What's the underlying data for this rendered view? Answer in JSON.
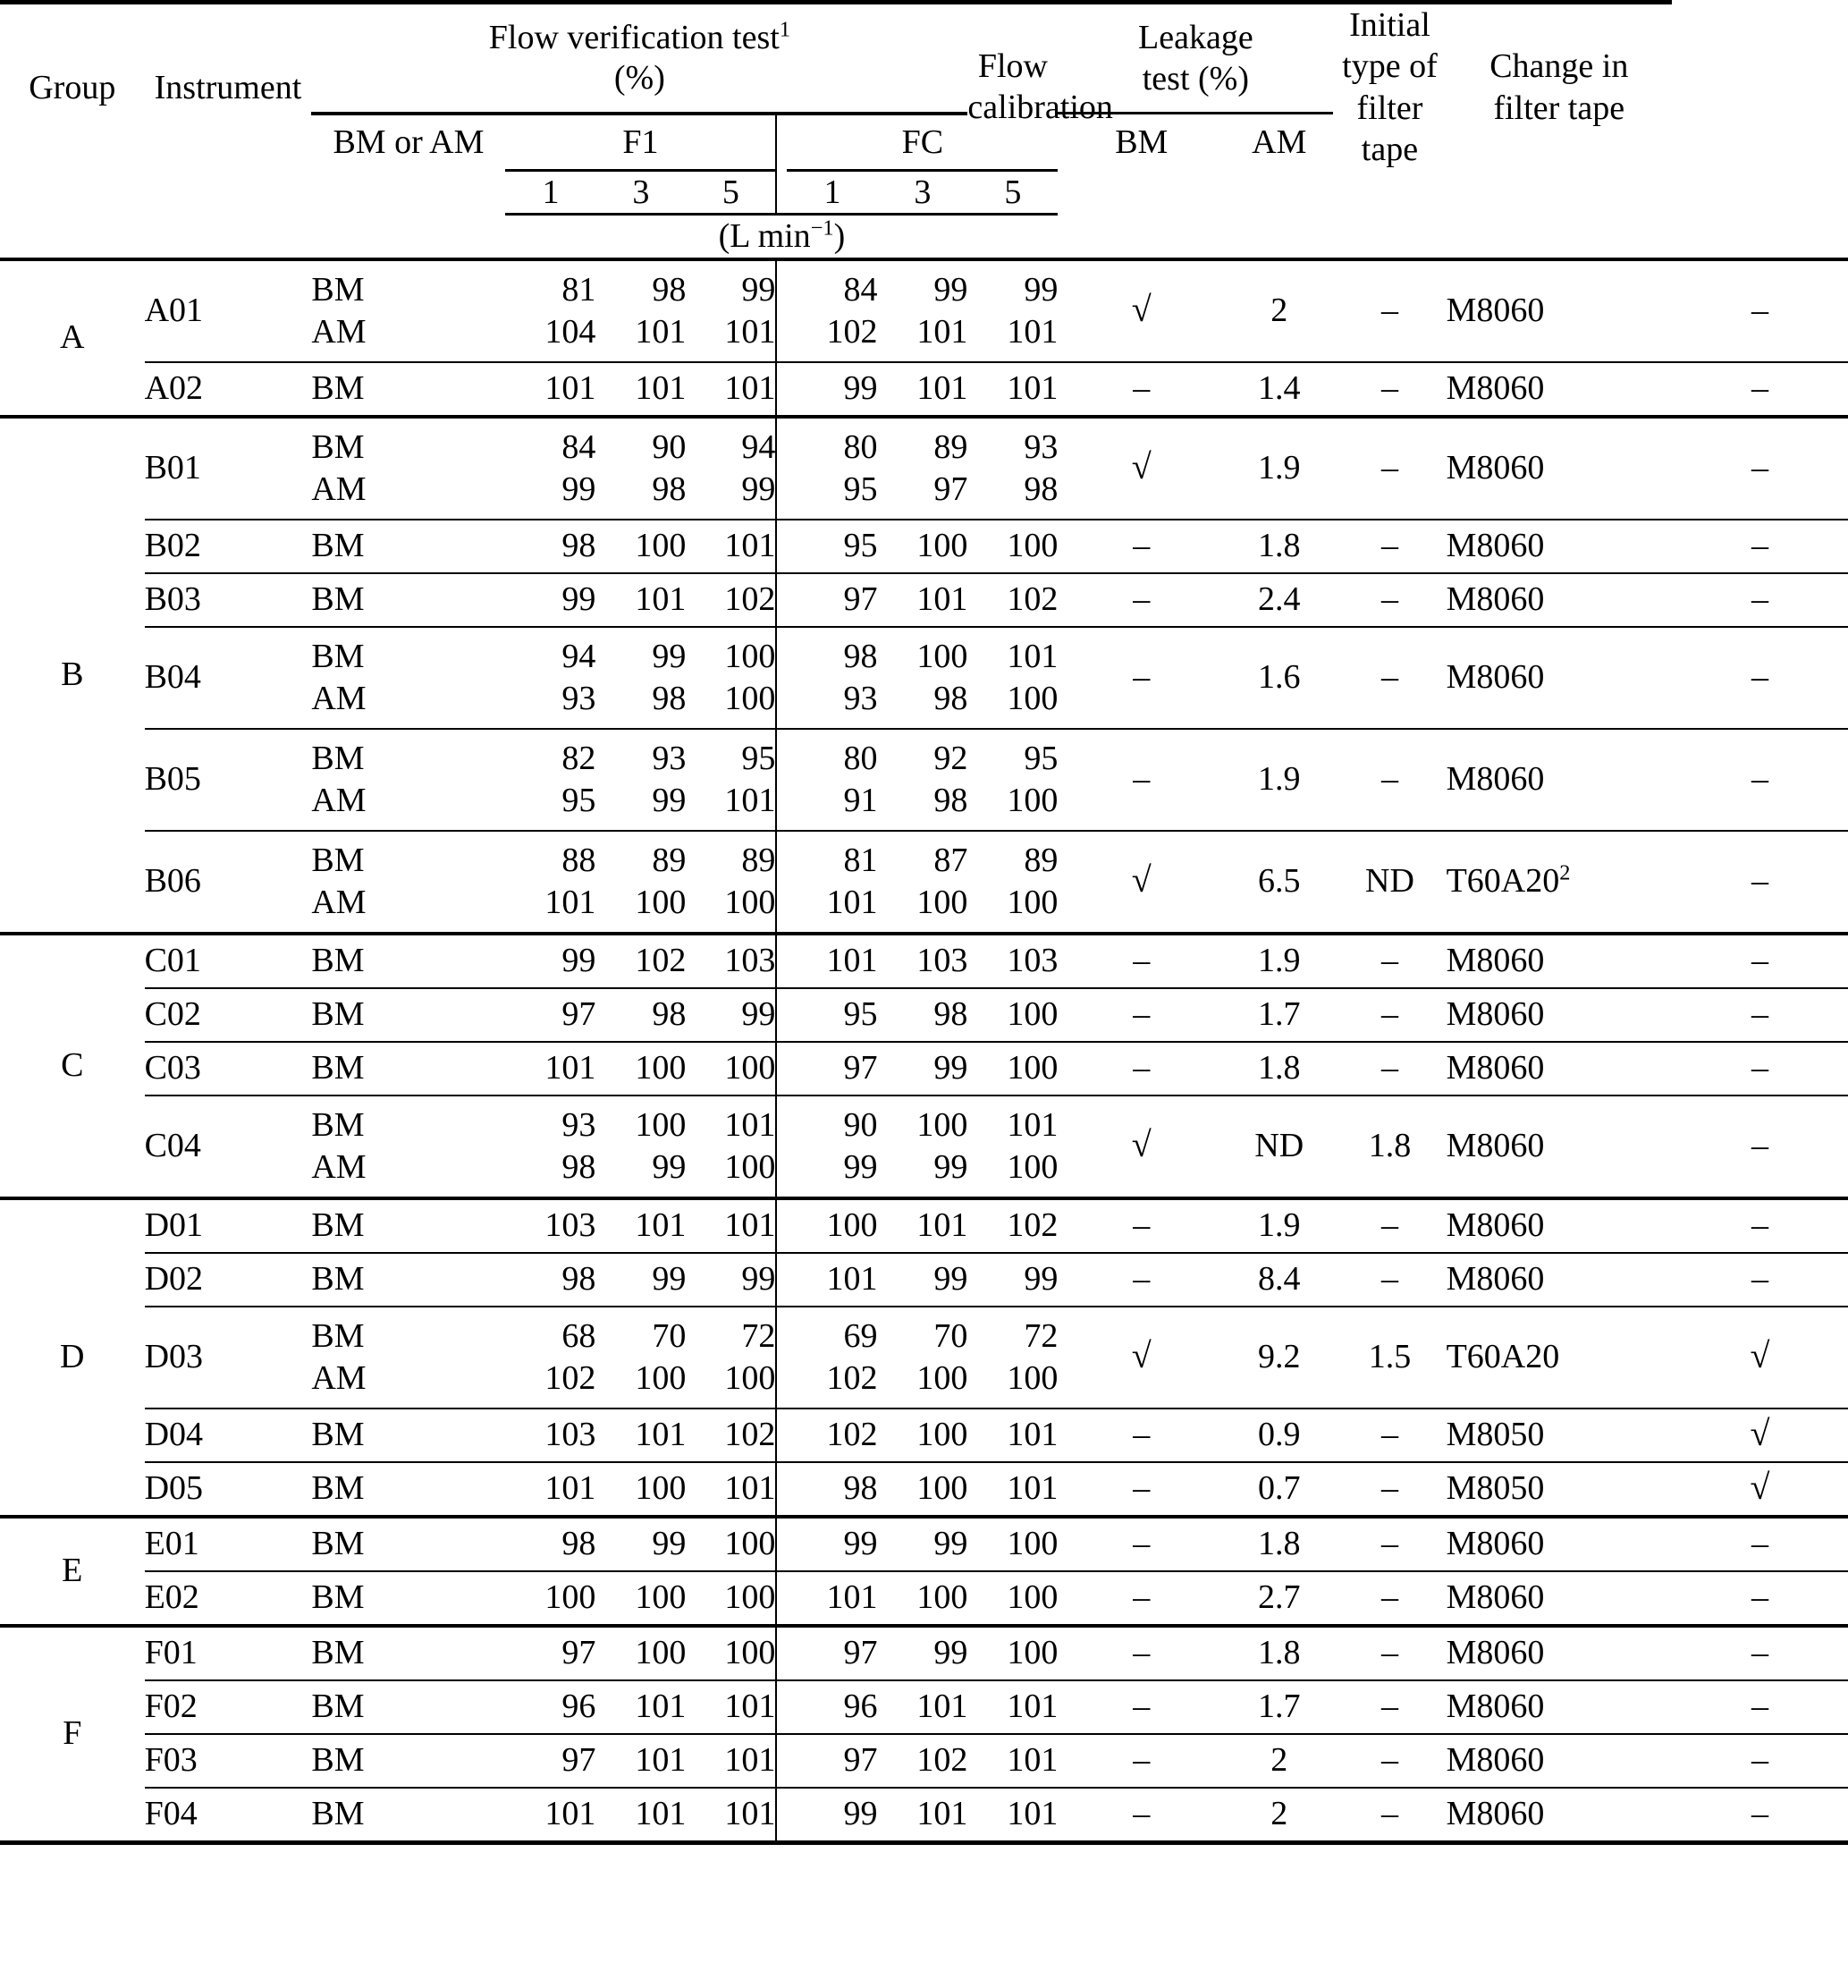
{
  "header": {
    "group": "Group",
    "instrument": "Instrument",
    "flow_verification_test": "Flow verification test",
    "flow_verification_test_sup": "1",
    "flow_verification_unit": "(%)",
    "bm_or_am": "BM or AM",
    "f1": "F1",
    "fc": "FC",
    "flow_rates": [
      "1",
      "3",
      "5"
    ],
    "rate_unit_prefix": "(L min",
    "rate_unit_sup": "−1",
    "rate_unit_suffix": ")",
    "flow_calibration_l1": "Flow",
    "flow_calibration_l2": "calibration",
    "leakage_l1": "Leakage",
    "leakage_l2": "test (%)",
    "leakage_bm": "BM",
    "leakage_am": "AM",
    "initial_tape_l1": "Initial type of",
    "initial_tape_l2": "filter tape",
    "change_tape_l1": "Change in",
    "change_tape_l2": "filter tape"
  },
  "symbols": {
    "check": "√",
    "dash": "–",
    "nd": "ND"
  },
  "groups": [
    {
      "name": "A",
      "rows": [
        {
          "instrument": "A01",
          "modes": [
            "BM",
            "AM"
          ],
          "f1": [
            [
              "81",
              "98",
              "99"
            ],
            [
              "104",
              "101",
              "101"
            ]
          ],
          "fc": [
            [
              "84",
              "99",
              "99"
            ],
            [
              "102",
              "101",
              "101"
            ]
          ],
          "flow_calibration": "√",
          "leakage_bm": "2",
          "leakage_am": "–",
          "initial_tape": "M8060",
          "initial_tape_sup": "",
          "change_tape": "–"
        },
        {
          "instrument": "A02",
          "modes": [
            "BM"
          ],
          "f1": [
            [
              "101",
              "101",
              "101"
            ]
          ],
          "fc": [
            [
              "99",
              "101",
              "101"
            ]
          ],
          "flow_calibration": "–",
          "leakage_bm": "1.4",
          "leakage_am": "–",
          "initial_tape": "M8060",
          "initial_tape_sup": "",
          "change_tape": "–"
        }
      ]
    },
    {
      "name": "B",
      "rows": [
        {
          "instrument": "B01",
          "modes": [
            "BM",
            "AM"
          ],
          "f1": [
            [
              "84",
              "90",
              "94"
            ],
            [
              "99",
              "98",
              "99"
            ]
          ],
          "fc": [
            [
              "80",
              "89",
              "93"
            ],
            [
              "95",
              "97",
              "98"
            ]
          ],
          "flow_calibration": "√",
          "leakage_bm": "1.9",
          "leakage_am": "–",
          "initial_tape": "M8060",
          "initial_tape_sup": "",
          "change_tape": "–"
        },
        {
          "instrument": "B02",
          "modes": [
            "BM"
          ],
          "f1": [
            [
              "98",
              "100",
              "101"
            ]
          ],
          "fc": [
            [
              "95",
              "100",
              "100"
            ]
          ],
          "flow_calibration": "–",
          "leakage_bm": "1.8",
          "leakage_am": "–",
          "initial_tape": "M8060",
          "initial_tape_sup": "",
          "change_tape": "–"
        },
        {
          "instrument": "B03",
          "modes": [
            "BM"
          ],
          "f1": [
            [
              "99",
              "101",
              "102"
            ]
          ],
          "fc": [
            [
              "97",
              "101",
              "102"
            ]
          ],
          "flow_calibration": "–",
          "leakage_bm": "2.4",
          "leakage_am": "–",
          "initial_tape": "M8060",
          "initial_tape_sup": "",
          "change_tape": "–"
        },
        {
          "instrument": "B04",
          "modes": [
            "BM",
            "AM"
          ],
          "f1": [
            [
              "94",
              "99",
              "100"
            ],
            [
              "93",
              "98",
              "100"
            ]
          ],
          "fc": [
            [
              "98",
              "100",
              "101"
            ],
            [
              "93",
              "98",
              "100"
            ]
          ],
          "flow_calibration": "–",
          "leakage_bm": "1.6",
          "leakage_am": "–",
          "initial_tape": "M8060",
          "initial_tape_sup": "",
          "change_tape": "–"
        },
        {
          "instrument": "B05",
          "modes": [
            "BM",
            "AM"
          ],
          "f1": [
            [
              "82",
              "93",
              "95"
            ],
            [
              "95",
              "99",
              "101"
            ]
          ],
          "fc": [
            [
              "80",
              "92",
              "95"
            ],
            [
              "91",
              "98",
              "100"
            ]
          ],
          "flow_calibration": "–",
          "leakage_bm": "1.9",
          "leakage_am": "–",
          "initial_tape": "M8060",
          "initial_tape_sup": "",
          "change_tape": "–"
        },
        {
          "instrument": "B06",
          "modes": [
            "BM",
            "AM"
          ],
          "f1": [
            [
              "88",
              "89",
              "89"
            ],
            [
              "101",
              "100",
              "100"
            ]
          ],
          "fc": [
            [
              "81",
              "87",
              "89"
            ],
            [
              "101",
              "100",
              "100"
            ]
          ],
          "flow_calibration": "√",
          "leakage_bm": "6.5",
          "leakage_am": "ND",
          "initial_tape": "T60A20",
          "initial_tape_sup": "2",
          "change_tape": "–"
        }
      ]
    },
    {
      "name": "C",
      "rows": [
        {
          "instrument": "C01",
          "modes": [
            "BM"
          ],
          "f1": [
            [
              "99",
              "102",
              "103"
            ]
          ],
          "fc": [
            [
              "101",
              "103",
              "103"
            ]
          ],
          "flow_calibration": "–",
          "leakage_bm": "1.9",
          "leakage_am": "–",
          "initial_tape": "M8060",
          "initial_tape_sup": "",
          "change_tape": "–"
        },
        {
          "instrument": "C02",
          "modes": [
            "BM"
          ],
          "f1": [
            [
              "97",
              "98",
              "99"
            ]
          ],
          "fc": [
            [
              "95",
              "98",
              "100"
            ]
          ],
          "flow_calibration": "–",
          "leakage_bm": "1.7",
          "leakage_am": "–",
          "initial_tape": "M8060",
          "initial_tape_sup": "",
          "change_tape": "–"
        },
        {
          "instrument": "C03",
          "modes": [
            "BM"
          ],
          "f1": [
            [
              "101",
              "100",
              "100"
            ]
          ],
          "fc": [
            [
              "97",
              "99",
              "100"
            ]
          ],
          "flow_calibration": "–",
          "leakage_bm": "1.8",
          "leakage_am": "–",
          "initial_tape": "M8060",
          "initial_tape_sup": "",
          "change_tape": "–"
        },
        {
          "instrument": "C04",
          "modes": [
            "BM",
            "AM"
          ],
          "f1": [
            [
              "93",
              "100",
              "101"
            ],
            [
              "98",
              "99",
              "100"
            ]
          ],
          "fc": [
            [
              "90",
              "100",
              "101"
            ],
            [
              "99",
              "99",
              "100"
            ]
          ],
          "flow_calibration": "√",
          "leakage_bm": "ND",
          "leakage_am": "1.8",
          "initial_tape": "M8060",
          "initial_tape_sup": "",
          "change_tape": "–"
        }
      ]
    },
    {
      "name": "D",
      "rows": [
        {
          "instrument": "D01",
          "modes": [
            "BM"
          ],
          "f1": [
            [
              "103",
              "101",
              "101"
            ]
          ],
          "fc": [
            [
              "100",
              "101",
              "102"
            ]
          ],
          "flow_calibration": "–",
          "leakage_bm": "1.9",
          "leakage_am": "–",
          "initial_tape": "M8060",
          "initial_tape_sup": "",
          "change_tape": "–"
        },
        {
          "instrument": "D02",
          "modes": [
            "BM"
          ],
          "f1": [
            [
              "98",
              "99",
              "99"
            ]
          ],
          "fc": [
            [
              "101",
              "99",
              "99"
            ]
          ],
          "flow_calibration": "–",
          "leakage_bm": "8.4",
          "leakage_am": "–",
          "initial_tape": "M8060",
          "initial_tape_sup": "",
          "change_tape": "–"
        },
        {
          "instrument": "D03",
          "modes": [
            "BM",
            "AM"
          ],
          "f1": [
            [
              "68",
              "70",
              "72"
            ],
            [
              "102",
              "100",
              "100"
            ]
          ],
          "fc": [
            [
              "69",
              "70",
              "72"
            ],
            [
              "102",
              "100",
              "100"
            ]
          ],
          "flow_calibration": "√",
          "leakage_bm": "9.2",
          "leakage_am": "1.5",
          "initial_tape": "T60A20",
          "initial_tape_sup": "",
          "change_tape": "√"
        },
        {
          "instrument": "D04",
          "modes": [
            "BM"
          ],
          "f1": [
            [
              "103",
              "101",
              "102"
            ]
          ],
          "fc": [
            [
              "102",
              "100",
              "101"
            ]
          ],
          "flow_calibration": "–",
          "leakage_bm": "0.9",
          "leakage_am": "–",
          "initial_tape": "M8050",
          "initial_tape_sup": "",
          "change_tape": "√"
        },
        {
          "instrument": "D05",
          "modes": [
            "BM"
          ],
          "f1": [
            [
              "101",
              "100",
              "101"
            ]
          ],
          "fc": [
            [
              "98",
              "100",
              "101"
            ]
          ],
          "flow_calibration": "–",
          "leakage_bm": "0.7",
          "leakage_am": "–",
          "initial_tape": "M8050",
          "initial_tape_sup": "",
          "change_tape": "√"
        }
      ]
    },
    {
      "name": "E",
      "rows": [
        {
          "instrument": "E01",
          "modes": [
            "BM"
          ],
          "f1": [
            [
              "98",
              "99",
              "100"
            ]
          ],
          "fc": [
            [
              "99",
              "99",
              "100"
            ]
          ],
          "flow_calibration": "–",
          "leakage_bm": "1.8",
          "leakage_am": "–",
          "initial_tape": "M8060",
          "initial_tape_sup": "",
          "change_tape": "–"
        },
        {
          "instrument": "E02",
          "modes": [
            "BM"
          ],
          "f1": [
            [
              "100",
              "100",
              "100"
            ]
          ],
          "fc": [
            [
              "101",
              "100",
              "100"
            ]
          ],
          "flow_calibration": "–",
          "leakage_bm": "2.7",
          "leakage_am": "–",
          "initial_tape": "M8060",
          "initial_tape_sup": "",
          "change_tape": "–"
        }
      ]
    },
    {
      "name": "F",
      "rows": [
        {
          "instrument": "F01",
          "modes": [
            "BM"
          ],
          "f1": [
            [
              "97",
              "100",
              "100"
            ]
          ],
          "fc": [
            [
              "97",
              "99",
              "100"
            ]
          ],
          "flow_calibration": "–",
          "leakage_bm": "1.8",
          "leakage_am": "–",
          "initial_tape": "M8060",
          "initial_tape_sup": "",
          "change_tape": "–"
        },
        {
          "instrument": "F02",
          "modes": [
            "BM"
          ],
          "f1": [
            [
              "96",
              "101",
              "101"
            ]
          ],
          "fc": [
            [
              "96",
              "101",
              "101"
            ]
          ],
          "flow_calibration": "–",
          "leakage_bm": "1.7",
          "leakage_am": "–",
          "initial_tape": "M8060",
          "initial_tape_sup": "",
          "change_tape": "–"
        },
        {
          "instrument": "F03",
          "modes": [
            "BM"
          ],
          "f1": [
            [
              "97",
              "101",
              "101"
            ]
          ],
          "fc": [
            [
              "97",
              "102",
              "101"
            ]
          ],
          "flow_calibration": "–",
          "leakage_bm": "2",
          "leakage_am": "–",
          "initial_tape": "M8060",
          "initial_tape_sup": "",
          "change_tape": "–"
        },
        {
          "instrument": "F04",
          "modes": [
            "BM"
          ],
          "f1": [
            [
              "101",
              "101",
              "101"
            ]
          ],
          "fc": [
            [
              "99",
              "101",
              "101"
            ]
          ],
          "flow_calibration": "–",
          "leakage_bm": "2",
          "leakage_am": "–",
          "initial_tape": "M8060",
          "initial_tape_sup": "",
          "change_tape": "–"
        }
      ]
    }
  ]
}
